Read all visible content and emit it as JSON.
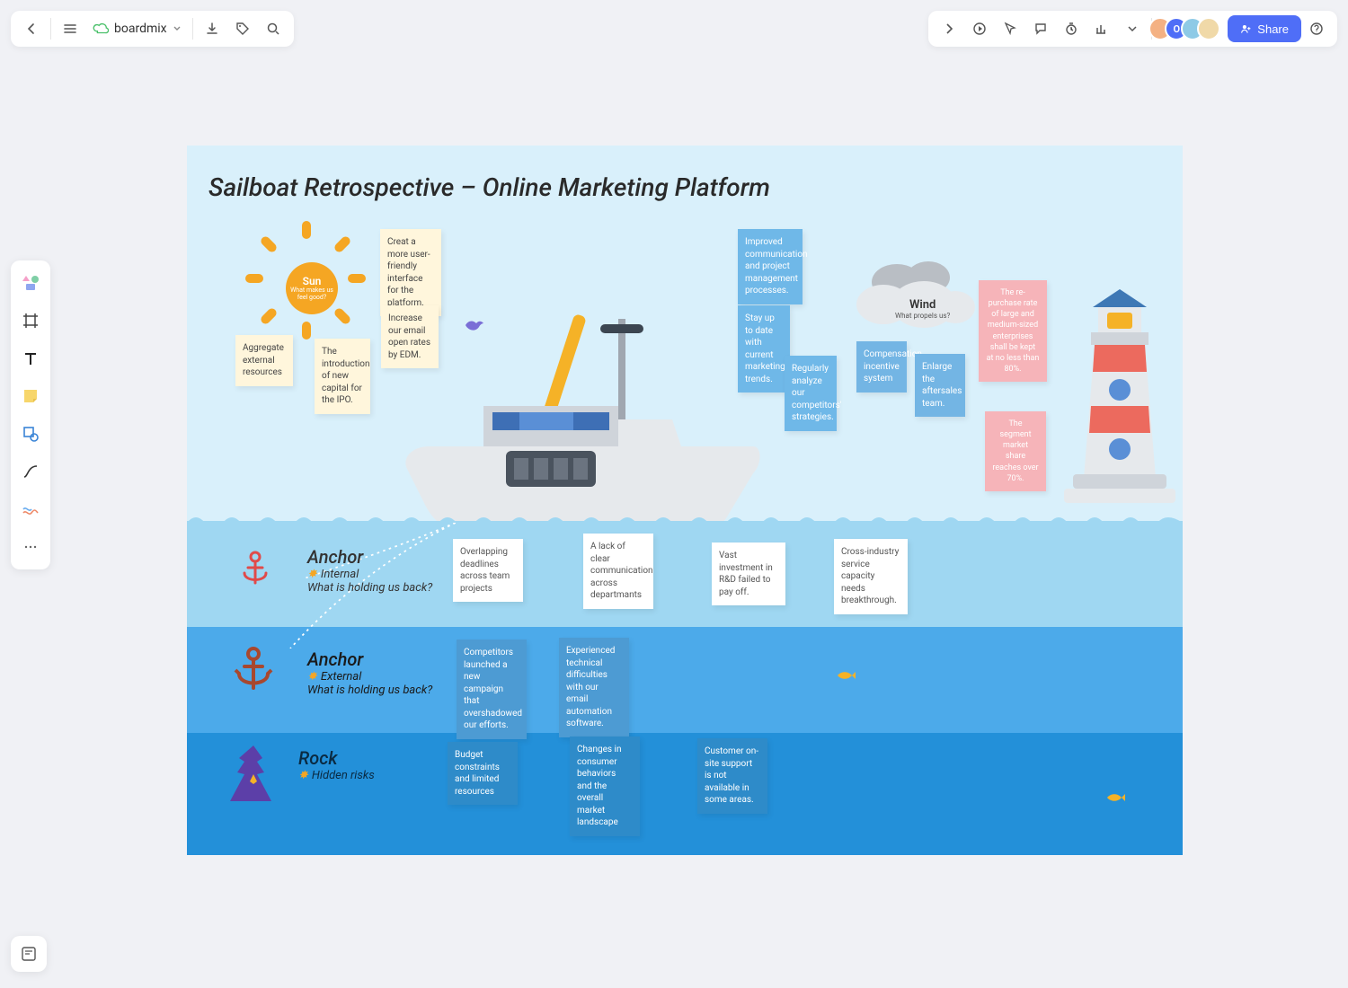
{
  "brand": "boardmix",
  "share_label": "Share",
  "board_title": "Sailboat Retrospective – Online Marketing Platform",
  "sun": {
    "title": "Sun",
    "subtitle": "What makes us feel good?"
  },
  "wind": {
    "title": "Wind",
    "subtitle": "What propels us?"
  },
  "sections": {
    "anchor_internal": {
      "title": "Anchor",
      "tag": "Internal",
      "question": "What is holding us back?"
    },
    "anchor_external": {
      "title": "Anchor",
      "tag": "External",
      "question": "What is holding us back?"
    },
    "rock": {
      "title": "Rock",
      "tag": "Hidden risks"
    }
  },
  "notes": {
    "sun1": "Creat a more user-friendly interface for the platform.",
    "sun2": "Aggregate external resources",
    "sun3": "The introduction of new capital for the IPO.",
    "sun4": "Increase our email open rates by EDM.",
    "wind1": "Improved communication and project management processes.",
    "wind2": "Stay up to date with current marketing trends.",
    "wind3": "Regularly analyze our competitors' strategies.",
    "wind4": "Compensation incentive system",
    "wind5": "Enlarge the aftersales team.",
    "goal1": "The re-purchase rate of large and medium-sized enterprises shall be kept at no less than 80%.",
    "goal2": "The segment market share reaches over 70%.",
    "ai1": "Overlapping deadlines across team projects",
    "ai2": "A lack of clear communication across departmants",
    "ai3": "Vast investment in R&D failed to pay off.",
    "ai4": "Cross-industry service capacity needs breakthrough.",
    "ae1": "Competitors launched a new campaign that overshadowed our efforts.",
    "ae2": "Experienced technical difficulties with our email automation software.",
    "r1": "Budget constraints and limited resources",
    "r2": "Changes in consumer behaviors and the overall market landscape",
    "r3": "Customer on-site support is not available in some areas."
  }
}
